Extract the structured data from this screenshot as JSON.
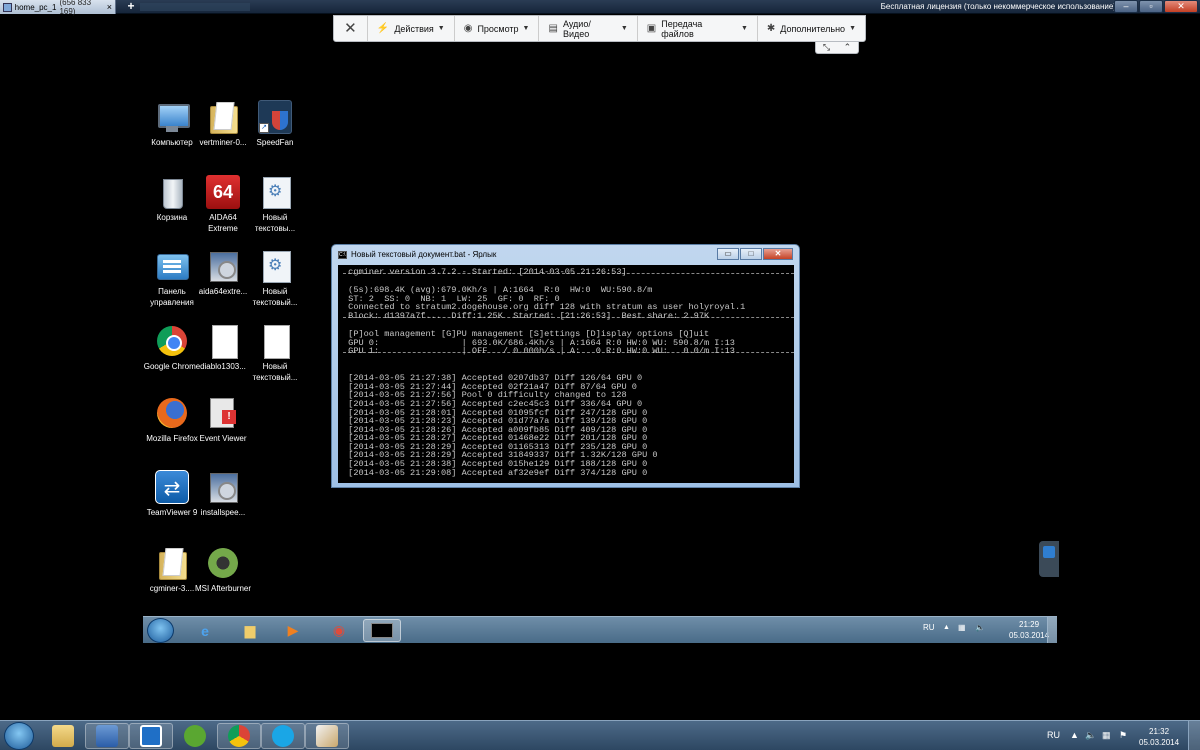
{
  "tabs": [
    {
      "name": "home_pc_1",
      "id": "(656 833 169)"
    }
  ],
  "license_text": "Бесплатная лицензия (только некоммерческое использование)",
  "toolbar": {
    "items": [
      {
        "label": "Действия",
        "icon": "lightning-icon"
      },
      {
        "label": "Просмотр",
        "icon": "eye-icon"
      },
      {
        "label": "Аудио/Видео",
        "icon": "chat-icon"
      },
      {
        "label": "Передача файлов",
        "icon": "file-transfer-icon"
      },
      {
        "label": "Дополнительно",
        "icon": "tools-icon"
      }
    ]
  },
  "desktop_icons": [
    {
      "label": "Компьютер",
      "icon": "computer"
    },
    {
      "label": "vertminer-0...",
      "icon": "folder"
    },
    {
      "label": "SpeedFan",
      "icon": "shield"
    },
    {
      "label": "Корзина",
      "icon": "bin"
    },
    {
      "label": "AIDA64 Extreme",
      "icon": "aida"
    },
    {
      "label": "Новый текстовы...",
      "icon": "doc"
    },
    {
      "label": "Панель управления",
      "icon": "panel"
    },
    {
      "label": "aida64extre...",
      "icon": "installer"
    },
    {
      "label": "Новый текстовый...",
      "icon": "doc"
    },
    {
      "label": "Google Chrome",
      "icon": "chrome"
    },
    {
      "label": "diablo1303...",
      "icon": "blank"
    },
    {
      "label": "Новый текстовый...",
      "icon": "blank"
    },
    {
      "label": "Mozilla Firefox",
      "icon": "firefox"
    },
    {
      "label": "Event Viewer",
      "icon": "event"
    },
    {
      "label": "TeamViewer 9",
      "icon": "teamviewer"
    },
    {
      "label": "installspee...",
      "icon": "installer"
    },
    {
      "label": "cgminer-3....",
      "icon": "folder"
    },
    {
      "label": "MSI Afterburner",
      "icon": "msi"
    }
  ],
  "console": {
    "title": "Новый текстовый документ.bat - Ярлык",
    "lines": [
      " cgminer version 3.7.2 - Started: [2014-03-05 21:26:53]",
      "",
      " (5s):698.4K (avg):679.0Kh/s | A:1664  R:0  HW:0  WU:590.8/m",
      " ST: 2  SS: 0  NB: 1  LW: 25  GF: 0  RF: 0",
      " Connected to stratum2.dogehouse.org diff 128 with stratum as user holyroyal.1",
      " Block: d1397a7f...  Diff:1.25K  Started: [21:26:53]  Best share: 2.97K",
      "",
      " [P]ool management [G]PU management [S]ettings [D]isplay options [Q]uit",
      " GPU 0:                | 693.0K/686.4Kh/s | A:1664 R:0 HW:0 WU: 590.8/m I:13",
      " GPU 1:                | OFF   / 0.000h/s | A:   0 R:0 HW:0 WU:   0.0/m I:13",
      "",
      "",
      " [2014-03-05 21:27:38] Accepted 0207db37 Diff 126/64 GPU 0",
      " [2014-03-05 21:27:44] Accepted 02f21a47 Diff 87/64 GPU 0",
      " [2014-03-05 21:27:56] Pool 0 difficulty changed to 128",
      " [2014-03-05 21:27:56] Accepted c2ec45c3 Diff 336/64 GPU 0",
      " [2014-03-05 21:28:01] Accepted 01095fcf Diff 247/128 GPU 0",
      " [2014-03-05 21:28:23] Accepted 01d77a7a Diff 139/128 GPU 0",
      " [2014-03-05 21:28:26] Accepted a009fb85 Diff 409/128 GPU 0",
      " [2014-03-05 21:28:27] Accepted 01468e22 Diff 201/128 GPU 0",
      " [2014-03-05 21:28:29] Accepted 01165313 Diff 235/128 GPU 0",
      " [2014-03-05 21:28:29] Accepted 31849337 Diff 1.32K/128 GPU 0",
      " [2014-03-05 21:28:38] Accepted 015he129 Diff 188/128 GPU 0",
      " [2014-03-05 21:29:08] Accepted af32e9ef Diff 374/128 GPU 0"
    ]
  },
  "remote_taskbar": {
    "lang": "RU",
    "time": "21:29",
    "date": "05.03.2014"
  },
  "local_taskbar": {
    "lang": "RU",
    "time": "21:32",
    "date": "05.03.2014"
  },
  "colors": {
    "accent": "#2d73d0",
    "console_bg": "#000000",
    "console_fg": "#c8c8c8"
  }
}
